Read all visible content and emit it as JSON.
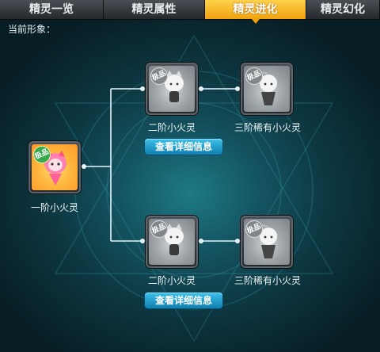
{
  "tabs": [
    {
      "label": "精灵一览",
      "active": false
    },
    {
      "label": "精灵属性",
      "active": false
    },
    {
      "label": "精灵进化",
      "active": true
    },
    {
      "label": "精灵幻化",
      "active": false
    }
  ],
  "current_form_label": "当前形象：",
  "root": {
    "name": "一阶小火灵",
    "badge": "极品",
    "icon": "pink-fire-sprite-icon"
  },
  "branches": [
    {
      "stage2": {
        "name": "二阶小火灵",
        "badge": "极品",
        "icon": "gray-sprite-icon"
      },
      "stage3": {
        "name": "三阶稀有小火灵",
        "badge": "极品",
        "icon": "gray-sprite-icon"
      },
      "detail_button": "查看详细信息"
    },
    {
      "stage2": {
        "name": "二阶小火灵",
        "badge": "极品",
        "icon": "gray-sprite-icon"
      },
      "stage3": {
        "name": "三阶稀有小火灵",
        "badge": "极品",
        "icon": "gray-sprite-icon"
      },
      "detail_button": "查看详细信息"
    }
  ],
  "colors": {
    "accent_tab": "#f0a20e",
    "button": "#1a9ad0",
    "connector": "#e9f6ff"
  }
}
